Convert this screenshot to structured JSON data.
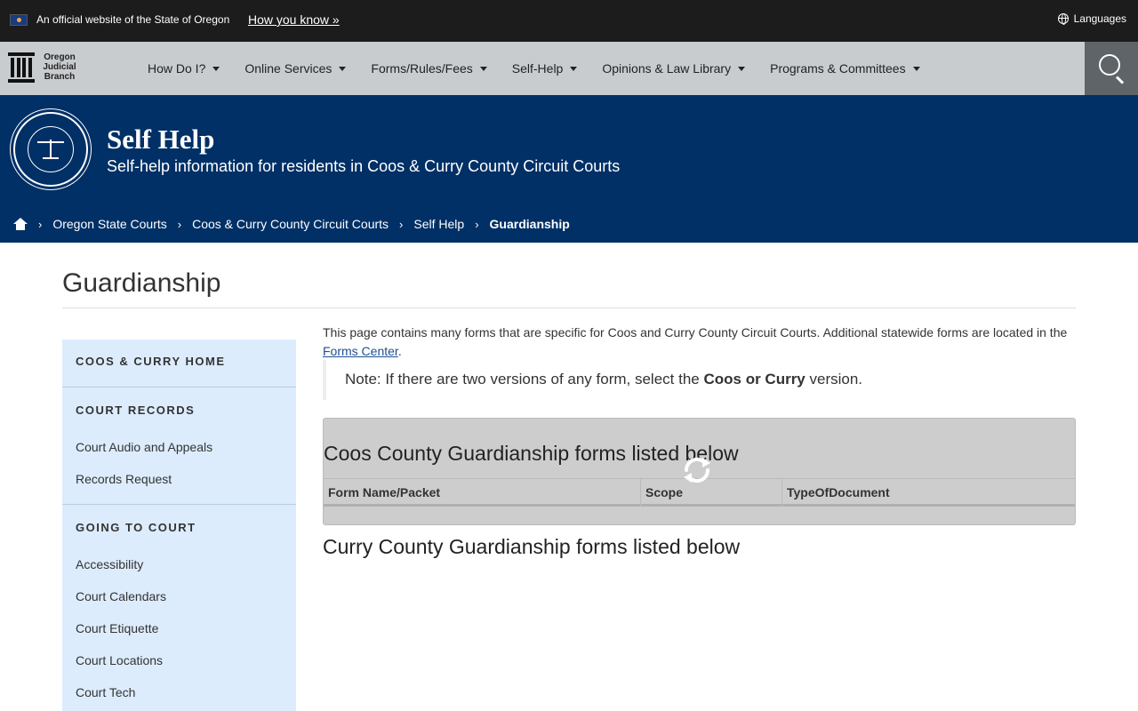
{
  "banner": {
    "official_text": "An official website of the State of Oregon",
    "how_you_know": "How you know »",
    "languages": "Languages"
  },
  "nav": {
    "logo_text": [
      "Oregon",
      "Judicial",
      "Branch"
    ],
    "items": [
      "How Do I?",
      "Online Services",
      "Forms/Rules/Fees",
      "Self-Help",
      "Opinions & Law Library",
      "Programs & Committees"
    ]
  },
  "hero": {
    "title": "Self Help",
    "subtitle": "Self-help information for residents in Coos & Curry County Circuit Courts"
  },
  "breadcrumb": [
    "Oregon State Courts",
    "Coos & Curry County Circuit Courts",
    "Self Help",
    "Guardianship"
  ],
  "page": {
    "title": "Guardianship",
    "intro": "This page contains many forms that are specific for Coos and Curry County Circuit Courts. Additional statewide forms are located in the",
    "intro_link": "Forms Center",
    "note_prefix": "Note: If there are two versions of any form, select the ",
    "note_bold": "Coos or Curry",
    "note_suffix": " version."
  },
  "sidebar": {
    "sections": [
      {
        "heading": "COOS & CURRY HOME",
        "links": []
      },
      {
        "heading": "COURT RECORDS",
        "links": [
          "Court Audio and Appeals",
          "Records Request"
        ]
      },
      {
        "heading": "GOING TO COURT",
        "links": [
          "Accessibility",
          "Court Calendars",
          "Court Etiquette",
          "Court Locations",
          "Court Tech"
        ]
      }
    ]
  },
  "coos_panel": {
    "title": "Coos County Guardianship forms listed below",
    "columns": [
      "Form Name/Packet",
      "Scope",
      "TypeOfDocument"
    ]
  },
  "curry_panel": {
    "title": "Curry County Guardianship forms listed below"
  }
}
